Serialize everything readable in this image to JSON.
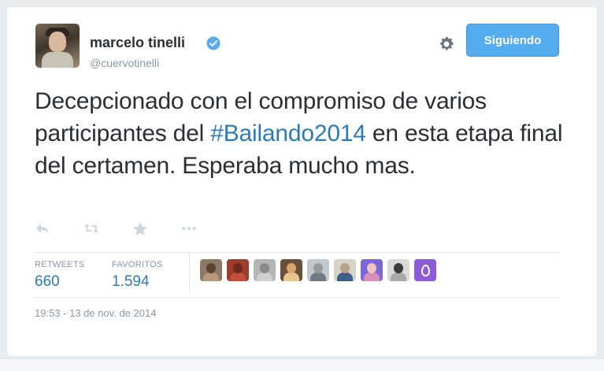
{
  "user": {
    "name": "marcelo tinelli",
    "handle": "@cuervotinelli"
  },
  "follow_button": {
    "label": "Siguiendo"
  },
  "tweet": {
    "text_before": "Decepcionado con el compromiso de varios participantes del ",
    "hashtag": "#Bailando2014",
    "text_after": " en esta etapa final del certamen. Esperaba mucho mas."
  },
  "actions": [
    "reply-icon",
    "retweet-icon",
    "favorite-icon",
    "more-icon"
  ],
  "stats": {
    "retweets_label": "RETWEETS",
    "retweets_value": "660",
    "favorites_label": "FAVORITOS",
    "favorites_value": "1.594"
  },
  "favoriters": [
    {
      "head": "#5a4330",
      "body": "#b89a7a",
      "bg": "#8c7a66"
    },
    {
      "head": "#6b2a1c",
      "body": "#c0503a",
      "bg": "#9e3d2b"
    },
    {
      "head": "#8a8a8a",
      "body": "#cfcfcf",
      "bg": "#b5b5b5"
    },
    {
      "head": "#d9a36a",
      "body": "#e8c48e",
      "bg": "#6a4f3a"
    },
    {
      "head": "#9a9a9a",
      "body": "#6f7a86",
      "bg": "#c3c8cc"
    },
    {
      "head": "#b7a188",
      "body": "#3b5f8a",
      "bg": "#d7d2c8"
    },
    {
      "head": "#f1c2c2",
      "body": "#d98fb7",
      "bg": "#7b68d6"
    },
    {
      "head": "#3a3a3a",
      "body": "#a9a9a9",
      "bg": "#d9d9d9"
    }
  ],
  "timestamp": "19:53 - 13 de nov. de 2014",
  "colors": {
    "accent": "#55acee",
    "link": "#2b7bb9",
    "muted": "#8899a6",
    "text": "#292f33"
  }
}
